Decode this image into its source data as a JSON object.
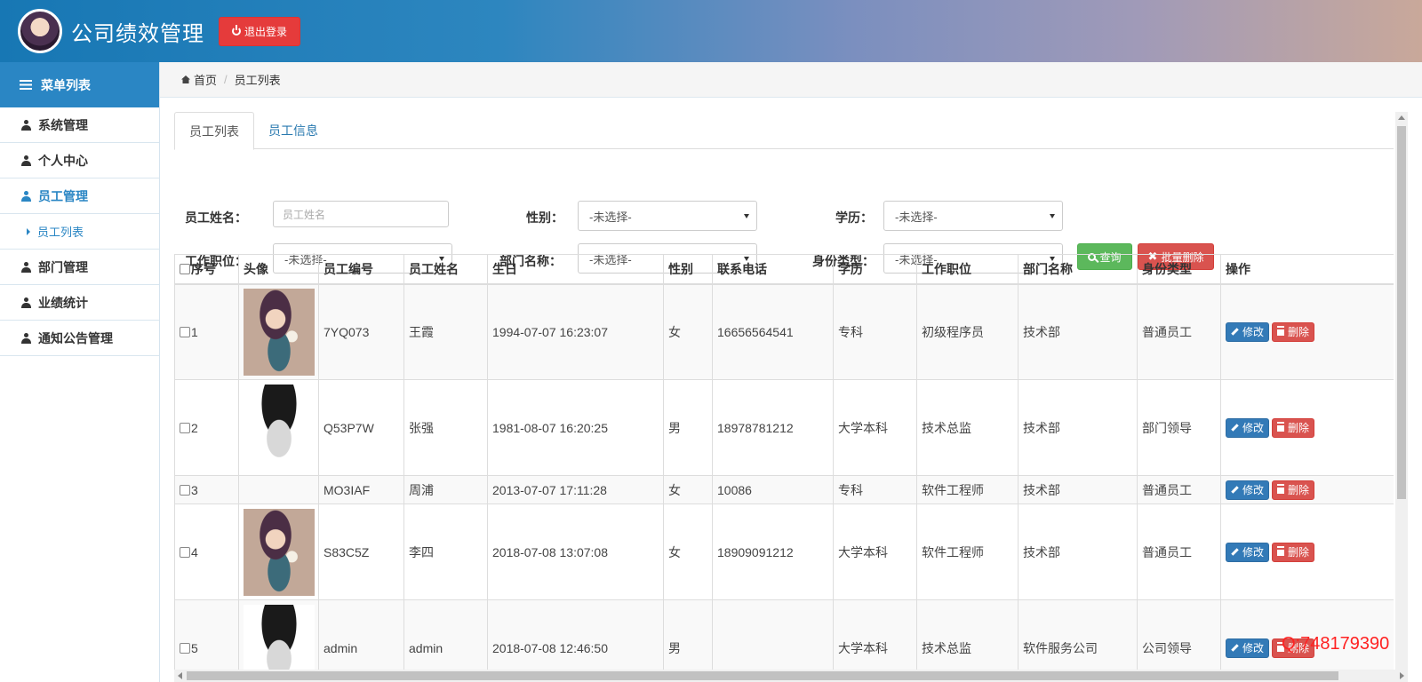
{
  "header": {
    "title": "公司绩效管理",
    "logout_label": "退出登录"
  },
  "sidebar": {
    "head": "菜单列表",
    "items": [
      {
        "label": "系统管理"
      },
      {
        "label": "个人中心"
      },
      {
        "label": "员工管理"
      },
      {
        "label": "员工列表"
      },
      {
        "label": "部门管理"
      },
      {
        "label": "业绩统计"
      },
      {
        "label": "通知公告管理"
      }
    ]
  },
  "breadcrumb": {
    "home": "首页",
    "current": "员工列表"
  },
  "tabs": [
    {
      "label": "员工列表"
    },
    {
      "label": "员工信息"
    }
  ],
  "filters": {
    "name_label": "员工姓名：",
    "name_placeholder": "员工姓名",
    "gender_label": "性别：",
    "gender_value": "-未选择-",
    "education_label": "学历：",
    "education_value": "-未选择-",
    "position_label": "工作职位：",
    "position_value": "-未选择-",
    "dept_label": "部门名称：",
    "dept_value": "-未选择-",
    "identity_label": "身份类型：",
    "identity_value": "-未选择-",
    "search_label": "查询",
    "batch_delete_label": "批量删除"
  },
  "table": {
    "headers": [
      "序号",
      "头像",
      "员工编号",
      "员工姓名",
      "生日",
      "性别",
      "联系电话",
      "学历",
      "工作职位",
      "部门名称",
      "身份类型",
      "操作"
    ],
    "edit_label": "修改",
    "delete_label": "删除",
    "rows": [
      {
        "no": "1",
        "photo": "cat-avatar",
        "code": "7YQ073",
        "name": "王霞",
        "birthday": "1994-07-07 16:23:07",
        "gender": "女",
        "phone": "16656564541",
        "education": "专科",
        "position": "初级程序员",
        "dept": "技术部",
        "identity": "普通员工"
      },
      {
        "no": "2",
        "photo": "man-avatar",
        "code": "Q53P7W",
        "name": "张强",
        "birthday": "1981-08-07 16:20:25",
        "gender": "男",
        "phone": "18978781212",
        "education": "大学本科",
        "position": "技术总监",
        "dept": "技术部",
        "identity": "部门领导"
      },
      {
        "no": "3",
        "photo": "",
        "code": "MO3IAF",
        "name": "周浦",
        "birthday": "2013-07-07 17:11:28",
        "gender": "女",
        "phone": "10086",
        "education": "专科",
        "position": "软件工程师",
        "dept": "技术部",
        "identity": "普通员工"
      },
      {
        "no": "4",
        "photo": "cat-avatar",
        "code": "S83C5Z",
        "name": "李四",
        "birthday": "2018-07-08 13:07:08",
        "gender": "女",
        "phone": "18909091212",
        "education": "大学本科",
        "position": "软件工程师",
        "dept": "技术部",
        "identity": "普通员工"
      },
      {
        "no": "5",
        "photo": "man-avatar",
        "code": "admin",
        "name": "admin",
        "birthday": "2018-07-08 12:46:50",
        "gender": "男",
        "phone": "",
        "education": "大学本科",
        "position": "技术总监",
        "dept": "软件服务公司",
        "identity": "公司领导"
      }
    ]
  },
  "watermark": "Q:748179390",
  "colors": {
    "primary": "#2a86c4",
    "success": "#5cb85c",
    "danger": "#d9534f",
    "edit": "#337ab7"
  }
}
